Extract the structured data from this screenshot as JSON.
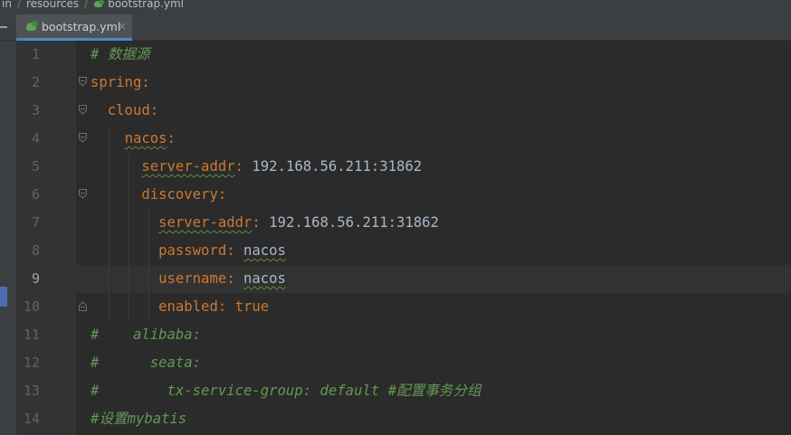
{
  "breadcrumb": {
    "items": [
      "in",
      "resources",
      "bootstrap.yml"
    ]
  },
  "tab": {
    "label": "bootstrap.yml",
    "close_glyph": "×",
    "icon": "yaml-file-icon"
  },
  "editor": {
    "active_line": 9,
    "lines": [
      {
        "n": "1"
      },
      {
        "n": "2"
      },
      {
        "n": "3"
      },
      {
        "n": "4"
      },
      {
        "n": "5"
      },
      {
        "n": "6"
      },
      {
        "n": "7"
      },
      {
        "n": "8"
      },
      {
        "n": "9"
      },
      {
        "n": "10"
      },
      {
        "n": "11"
      },
      {
        "n": "12"
      },
      {
        "n": "13"
      },
      {
        "n": "14"
      }
    ],
    "tokens": {
      "l1_comment": "# 数据源",
      "l2_key": "spring",
      "l3_key": "cloud",
      "l4_key": "nacos",
      "l5_key": "server-addr",
      "l5_value": "192.168.56.211:31862",
      "l6_key": "discovery",
      "l7_key": "server-addr",
      "l7_value": "192.168.56.211:31862",
      "l8_key": "password",
      "l8_value": "nacos",
      "l9_key": "username",
      "l9_value": "nacos",
      "l10_key": "enabled",
      "l10_value": "true",
      "l11_comment": "#    alibaba:",
      "l12_comment": "#      seata:",
      "l13_comment": "#        tx-service-group: default #配置事务分组",
      "l14_comment": "#设置mybatis",
      "colon": ":"
    }
  },
  "colors": {
    "background": "#2b2b2b",
    "keyword": "#cc7832",
    "value": "#a9b7c6",
    "comment": "#629755",
    "line_number": "#606366",
    "tab_underline": "#4a88c7"
  }
}
